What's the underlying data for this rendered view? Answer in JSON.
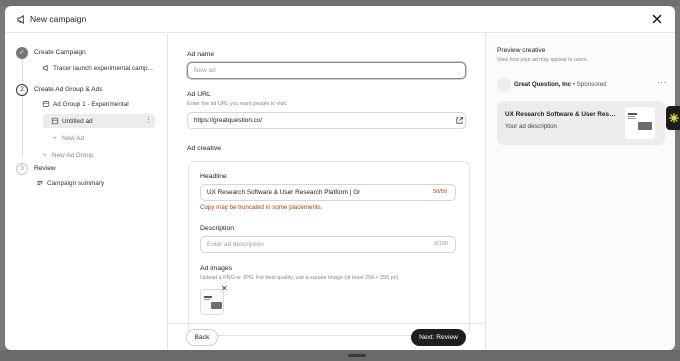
{
  "header": {
    "title": "New campaign",
    "icon": "megaphone-icon",
    "close_icon": "close-icon"
  },
  "rail": {
    "steps": [
      {
        "number": "✓",
        "label": "Create Campaign",
        "state": "done"
      },
      {
        "number": "2",
        "label": "Create Ad Group & Ads",
        "state": "active"
      },
      {
        "number": "3",
        "label": "Review",
        "state": "todo"
      }
    ],
    "campaign_item": "Tracer launch experimental camp...",
    "ad_group_item": "Ad Group 1 - Experimental",
    "ad_item": "Untitled ad",
    "new_ad": "New Ad",
    "new_ad_group": "New Ad Group",
    "campaign_summary": "Campaign summary"
  },
  "form": {
    "ad_name": {
      "label": "Ad name",
      "placeholder": "New ad",
      "value": ""
    },
    "ad_url": {
      "label": "Ad URL",
      "hint": "Enter the ad URL you want people to visit.",
      "value": "https://greatquestion.co/"
    },
    "ad_creative_label": "Ad creative",
    "headline": {
      "label": "Headline",
      "value": "UX Research Software & User Research Platform | Gr",
      "counter": "50/50",
      "warning": "Copy may be truncated in some placements."
    },
    "description": {
      "label": "Description",
      "placeholder": "Enter ad description",
      "counter": "0/100"
    },
    "ad_images": {
      "label": "Ad images",
      "hint": "Upload a PNG or JPG. For best quality, use a square image (at least 256 × 256 px)."
    }
  },
  "footer": {
    "back": "Back",
    "next": "Next: Review"
  },
  "preview": {
    "title": "Preview creative",
    "subtitle": "View how your ad may appear to users.",
    "company": "Great Question, Inc",
    "sponsored": " • Sponsored",
    "more": "···",
    "card_headline": "UX Research Software & User Resea...",
    "card_description": "Your ad description"
  },
  "colors": {
    "primary_button": "#1e1e1e",
    "warning_text": "#b33a1f",
    "side_tab_accent": "#f3e34d"
  }
}
